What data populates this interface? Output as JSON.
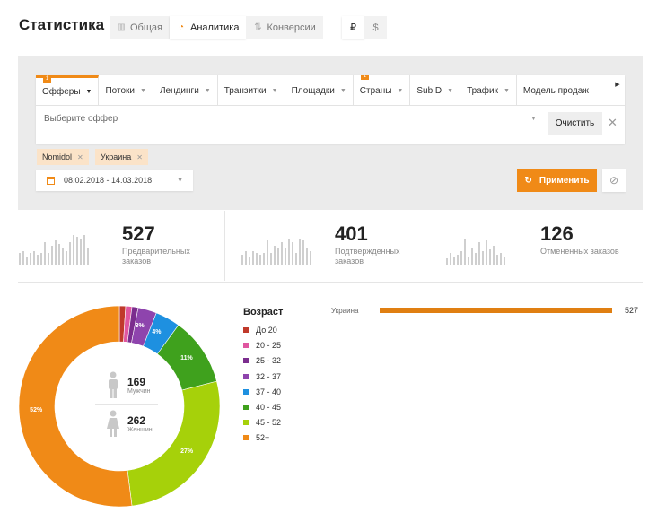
{
  "page": {
    "title": "Статистика"
  },
  "view_tabs": [
    {
      "label": "Общая",
      "icon": "bar-chart-icon"
    },
    {
      "label": "Аналитика",
      "icon": "pie-chart-icon",
      "active": true
    },
    {
      "label": "Конверсии",
      "icon": "sort-arrows-icon"
    }
  ],
  "currency": {
    "rub": "₽",
    "usd": "$"
  },
  "filters": {
    "tabs": [
      {
        "label": "Офферы",
        "badge": "1",
        "active": true
      },
      {
        "label": "Потоки"
      },
      {
        "label": "Лендинги"
      },
      {
        "label": "Транзитки"
      },
      {
        "label": "Площадки"
      },
      {
        "label": "Страны",
        "badge": "1"
      },
      {
        "label": "SubID"
      },
      {
        "label": "Трафик"
      },
      {
        "label": "Модель продаж"
      }
    ],
    "select_placeholder": "Выберите оффер",
    "clear_label": "Очистить",
    "chips": [
      {
        "label": "Nomidol"
      },
      {
        "label": "Украина"
      }
    ],
    "date_range": "08.02.2018 - 14.03.2018",
    "apply_label": "Применить"
  },
  "stats": [
    {
      "value": "527",
      "label": "Предварительных заказов"
    },
    {
      "value": "401",
      "label": "Подтвержденных заказов"
    },
    {
      "value": "126",
      "label": "Отмененных заказов"
    }
  ],
  "gender": {
    "men_count": "169",
    "men_label": "Мужчин",
    "women_count": "262",
    "women_label": "Женщин"
  },
  "age_legend": {
    "title": "Возраст",
    "items": [
      {
        "label": "До 20",
        "color": "#c0392b"
      },
      {
        "label": "20 - 25",
        "color": "#e056a0"
      },
      {
        "label": "25 - 32",
        "color": "#7b2d8e"
      },
      {
        "label": "32 - 37",
        "color": "#8e44ad"
      },
      {
        "label": "37 - 40",
        "color": "#1e90e0"
      },
      {
        "label": "40 - 45",
        "color": "#3fa11d"
      },
      {
        "label": "45 - 52",
        "color": "#a6d10a"
      },
      {
        "label": "52+",
        "color": "#f08a17"
      }
    ]
  },
  "countries": [
    {
      "name": "Украина",
      "value": "527"
    }
  ],
  "chart_data": {
    "type": "pie",
    "categories": [
      "До 20",
      "20 - 25",
      "25 - 32",
      "32 - 37",
      "37 - 40",
      "40 - 45",
      "45 - 52",
      "52+"
    ],
    "values": [
      1,
      1,
      1,
      3,
      4,
      11,
      27,
      52
    ],
    "labels": [
      "",
      "",
      "",
      "3%",
      "4%",
      "11%",
      "27%",
      "52%"
    ],
    "colors": [
      "#c0392b",
      "#e056a0",
      "#7b2d8e",
      "#8e44ad",
      "#1e90e0",
      "#3fa11d",
      "#a6d10a",
      "#f08a17"
    ]
  }
}
